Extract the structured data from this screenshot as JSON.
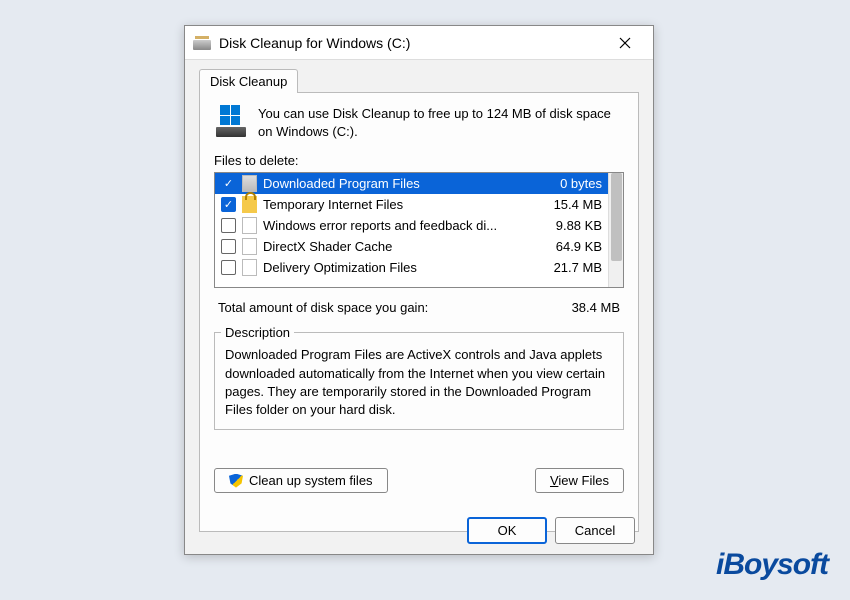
{
  "window": {
    "title": "Disk Cleanup for Windows (C:)"
  },
  "tab": {
    "label": "Disk Cleanup"
  },
  "info_text": "You can use Disk Cleanup to free up to 124 MB of disk space on Windows (C:).",
  "files_label": "Files to delete:",
  "files": [
    {
      "name": "Downloaded Program Files",
      "size": "0 bytes",
      "checked": true,
      "selected": true,
      "icon": "gray"
    },
    {
      "name": "Temporary Internet Files",
      "size": "15.4 MB",
      "checked": true,
      "selected": false,
      "icon": "lock"
    },
    {
      "name": "Windows error reports and feedback di...",
      "size": "9.88 KB",
      "checked": false,
      "selected": false,
      "icon": "file"
    },
    {
      "name": "DirectX Shader Cache",
      "size": "64.9 KB",
      "checked": false,
      "selected": false,
      "icon": "file"
    },
    {
      "name": "Delivery Optimization Files",
      "size": "21.7 MB",
      "checked": false,
      "selected": false,
      "icon": "file"
    }
  ],
  "total": {
    "label": "Total amount of disk space you gain:",
    "value": "38.4 MB"
  },
  "description": {
    "legend": "Description",
    "text": "Downloaded Program Files are ActiveX controls and Java applets downloaded automatically from the Internet when you view certain pages. They are temporarily stored in the Downloaded Program Files folder on your hard disk."
  },
  "buttons": {
    "cleanup": "Clean up system files",
    "view": "View Files",
    "ok": "OK",
    "cancel": "Cancel"
  },
  "watermark": "iBoysoft"
}
